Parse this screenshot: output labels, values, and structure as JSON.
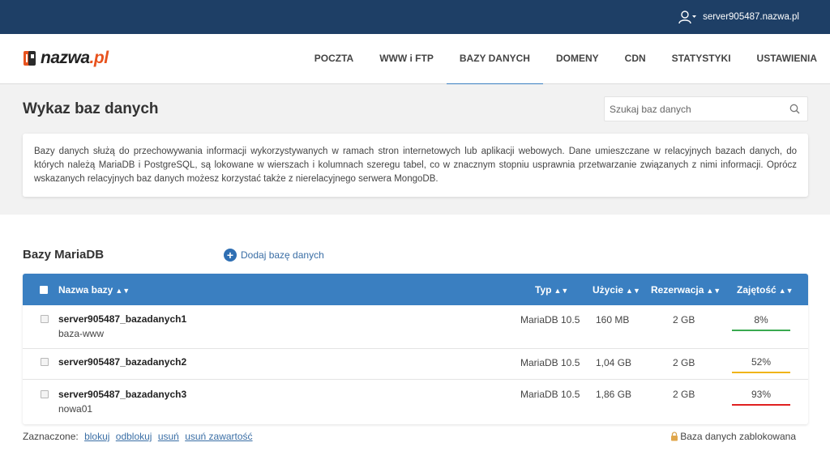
{
  "header": {
    "server": "server905487.nazwa.pl"
  },
  "logo": {
    "main": "nazwa",
    "suffix": ".pl"
  },
  "nav": {
    "items": [
      "POCZTA",
      "WWW i FTP",
      "BAZY DANYCH",
      "DOMENY",
      "CDN",
      "STATYSTYKI",
      "USTAWIENIA"
    ],
    "active": "BAZY DANYCH"
  },
  "page": {
    "title": "Wykaz baz danych",
    "search_placeholder": "Szukaj baz danych",
    "info": "Bazy danych służą do przechowywania informacji wykorzystywanych w ramach stron internetowych lub aplikacji webowych. Dane umieszczane w relacyjnych bazach danych, do których należą MariaDB i PostgreSQL, są lokowane w wierszach i kolumnach szeregu tabel, co w znacznym stopniu usprawnia przetwarzanie związanych z nimi informacji. Oprócz wskazanych relacyjnych baz danych możesz korzystać także z nierelacyjnego serwera MongoDB."
  },
  "section": {
    "title": "Bazy MariaDB",
    "add_label": "Dodaj bazę danych"
  },
  "table": {
    "headers": {
      "name": "Nazwa bazy",
      "type": "Typ",
      "usage": "Użycie",
      "reservation": "Rezerwacja",
      "occupancy": "Zajętość"
    },
    "sort_glyph": "▲▼",
    "rows": [
      {
        "name": "server905487_bazadanych1",
        "desc": "baza-www",
        "type": "MariaDB 10.5",
        "usage": "160 MB",
        "reservation": "2 GB",
        "occupancy": "8%",
        "bar_color": "#3aaa50"
      },
      {
        "name": "server905487_bazadanych2",
        "desc": "",
        "type": "MariaDB 10.5",
        "usage": "1,04 GB",
        "reservation": "2 GB",
        "occupancy": "52%",
        "bar_color": "#f0b418"
      },
      {
        "name": "server905487_bazadanych3",
        "desc": "nowa01",
        "type": "MariaDB 10.5",
        "usage": "1,86 GB",
        "reservation": "2 GB",
        "occupancy": "93%",
        "bar_color": "#e02020"
      }
    ]
  },
  "footer": {
    "selected_label": "Zaznaczone:",
    "actions": [
      "blokuj",
      "odblokuj",
      "usuń",
      "usuń zawartość"
    ],
    "locked_label": "Baza danych zablokowana"
  },
  "colors": {
    "topbar": "#1e3f66",
    "accent": "#3a7fc1",
    "link": "#3a6ea5",
    "logo_accent": "#e8531e"
  }
}
